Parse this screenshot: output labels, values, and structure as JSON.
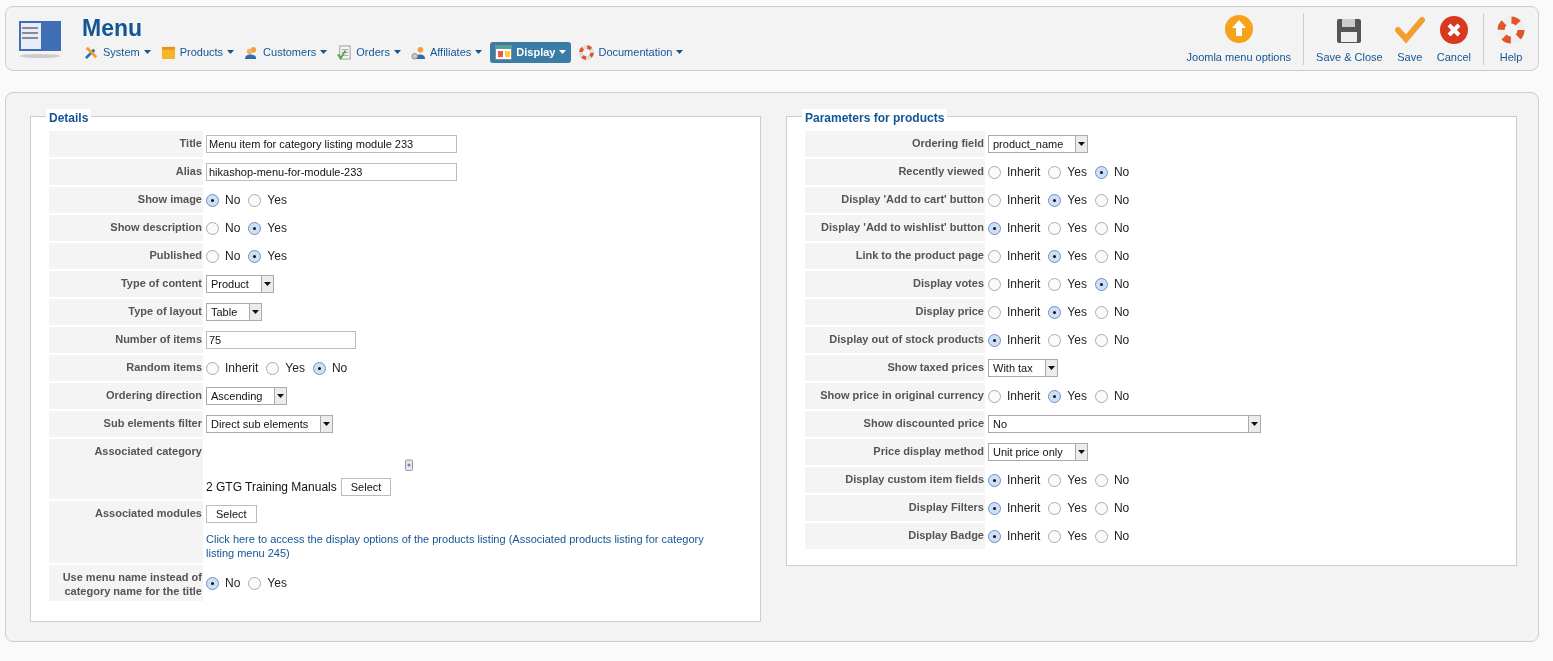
{
  "header": {
    "title": "Menu",
    "menu": [
      {
        "label": "System",
        "selected": false
      },
      {
        "label": "Products",
        "selected": false
      },
      {
        "label": "Customers",
        "selected": false
      },
      {
        "label": "Orders",
        "selected": false
      },
      {
        "label": "Affiliates",
        "selected": false
      },
      {
        "label": "Display",
        "selected": true
      },
      {
        "label": "Documentation",
        "selected": false
      }
    ],
    "toolbar": [
      {
        "label": "Joomla menu options",
        "kind": "up"
      },
      {
        "label": "Save & Close",
        "kind": "disk"
      },
      {
        "label": "Save",
        "kind": "check"
      },
      {
        "label": "Cancel",
        "kind": "cancel"
      },
      {
        "label": "Help",
        "kind": "help"
      }
    ]
  },
  "details": {
    "legend": "Details",
    "rows": [
      {
        "label": "Title",
        "kind": "text",
        "value": "Menu item for category listing module 233"
      },
      {
        "label": "Alias",
        "kind": "text",
        "value": "hikashop-menu-for-module-233"
      },
      {
        "label": "Show image",
        "kind": "radio",
        "options": [
          {
            "label": "No",
            "selected": true
          },
          {
            "label": "Yes",
            "selected": false
          }
        ]
      },
      {
        "label": "Show description",
        "kind": "radio",
        "options": [
          {
            "label": "No",
            "selected": false
          },
          {
            "label": "Yes",
            "selected": true
          }
        ]
      },
      {
        "label": "Published",
        "kind": "radio",
        "options": [
          {
            "label": "No",
            "selected": false
          },
          {
            "label": "Yes",
            "selected": true
          }
        ]
      },
      {
        "label": "Type of content",
        "kind": "select",
        "value": "Product"
      },
      {
        "label": "Type of layout",
        "kind": "select",
        "value": "Table"
      },
      {
        "label": "Number of items",
        "kind": "number",
        "value": "75"
      },
      {
        "label": "Random items",
        "kind": "radio",
        "options": [
          {
            "label": "Inherit",
            "selected": false
          },
          {
            "label": "Yes",
            "selected": false
          },
          {
            "label": "No",
            "selected": true
          }
        ]
      },
      {
        "label": "Ordering direction",
        "kind": "select",
        "value": "Ascending"
      },
      {
        "label": "Sub elements filter",
        "kind": "select",
        "value": "Direct sub elements"
      },
      {
        "label": "Associated category",
        "kind": "category",
        "value": "2 GTG Training Manuals",
        "button": "Select"
      },
      {
        "label": "Associated modules",
        "kind": "modules",
        "button": "Select",
        "link": "Click here to access the display options of the products listing (Associated products listing for category listing menu 245)"
      },
      {
        "label": "Use menu name instead of category name for the title",
        "kind": "radio",
        "options": [
          {
            "label": "No",
            "selected": true
          },
          {
            "label": "Yes",
            "selected": false
          }
        ]
      }
    ]
  },
  "parameters": {
    "legend": "Parameters for products",
    "rows": [
      {
        "label": "Ordering field",
        "kind": "select",
        "value": "product_name"
      },
      {
        "label": "Recently viewed",
        "kind": "radio",
        "options": [
          {
            "label": "Inherit",
            "selected": false
          },
          {
            "label": "Yes",
            "selected": false
          },
          {
            "label": "No",
            "selected": true
          }
        ]
      },
      {
        "label": "Display 'Add to cart' button",
        "kind": "radio",
        "options": [
          {
            "label": "Inherit",
            "selected": false
          },
          {
            "label": "Yes",
            "selected": true
          },
          {
            "label": "No",
            "selected": false
          }
        ]
      },
      {
        "label": "Display 'Add to wishlist' button",
        "kind": "radio",
        "options": [
          {
            "label": "Inherit",
            "selected": true
          },
          {
            "label": "Yes",
            "selected": false
          },
          {
            "label": "No",
            "selected": false
          }
        ]
      },
      {
        "label": "Link to the product page",
        "kind": "radio",
        "options": [
          {
            "label": "Inherit",
            "selected": false
          },
          {
            "label": "Yes",
            "selected": true
          },
          {
            "label": "No",
            "selected": false
          }
        ]
      },
      {
        "label": "Display votes",
        "kind": "radio",
        "options": [
          {
            "label": "Inherit",
            "selected": false
          },
          {
            "label": "Yes",
            "selected": false
          },
          {
            "label": "No",
            "selected": true
          }
        ]
      },
      {
        "label": "Display price",
        "kind": "radio",
        "options": [
          {
            "label": "Inherit",
            "selected": false
          },
          {
            "label": "Yes",
            "selected": true
          },
          {
            "label": "No",
            "selected": false
          }
        ]
      },
      {
        "label": "Display out of stock products",
        "kind": "radio",
        "options": [
          {
            "label": "Inherit",
            "selected": true
          },
          {
            "label": "Yes",
            "selected": false
          },
          {
            "label": "No",
            "selected": false
          }
        ]
      },
      {
        "label": "Show taxed prices",
        "kind": "select",
        "value": "With tax"
      },
      {
        "label": "Show price in original currency",
        "kind": "radio",
        "options": [
          {
            "label": "Inherit",
            "selected": false
          },
          {
            "label": "Yes",
            "selected": true
          },
          {
            "label": "No",
            "selected": false
          }
        ]
      },
      {
        "label": "Show discounted price",
        "kind": "wideselect",
        "value": "No"
      },
      {
        "label": "Price display method",
        "kind": "select",
        "value": "Unit price only"
      },
      {
        "label": "Display custom item fields",
        "kind": "radio",
        "options": [
          {
            "label": "Inherit",
            "selected": true
          },
          {
            "label": "Yes",
            "selected": false
          },
          {
            "label": "No",
            "selected": false
          }
        ]
      },
      {
        "label": "Display Filters",
        "kind": "radio",
        "options": [
          {
            "label": "Inherit",
            "selected": true
          },
          {
            "label": "Yes",
            "selected": false
          },
          {
            "label": "No",
            "selected": false
          }
        ]
      },
      {
        "label": "Display Badge",
        "kind": "radio",
        "options": [
          {
            "label": "Inherit",
            "selected": true
          },
          {
            "label": "Yes",
            "selected": false
          },
          {
            "label": "No",
            "selected": false
          }
        ]
      }
    ]
  }
}
